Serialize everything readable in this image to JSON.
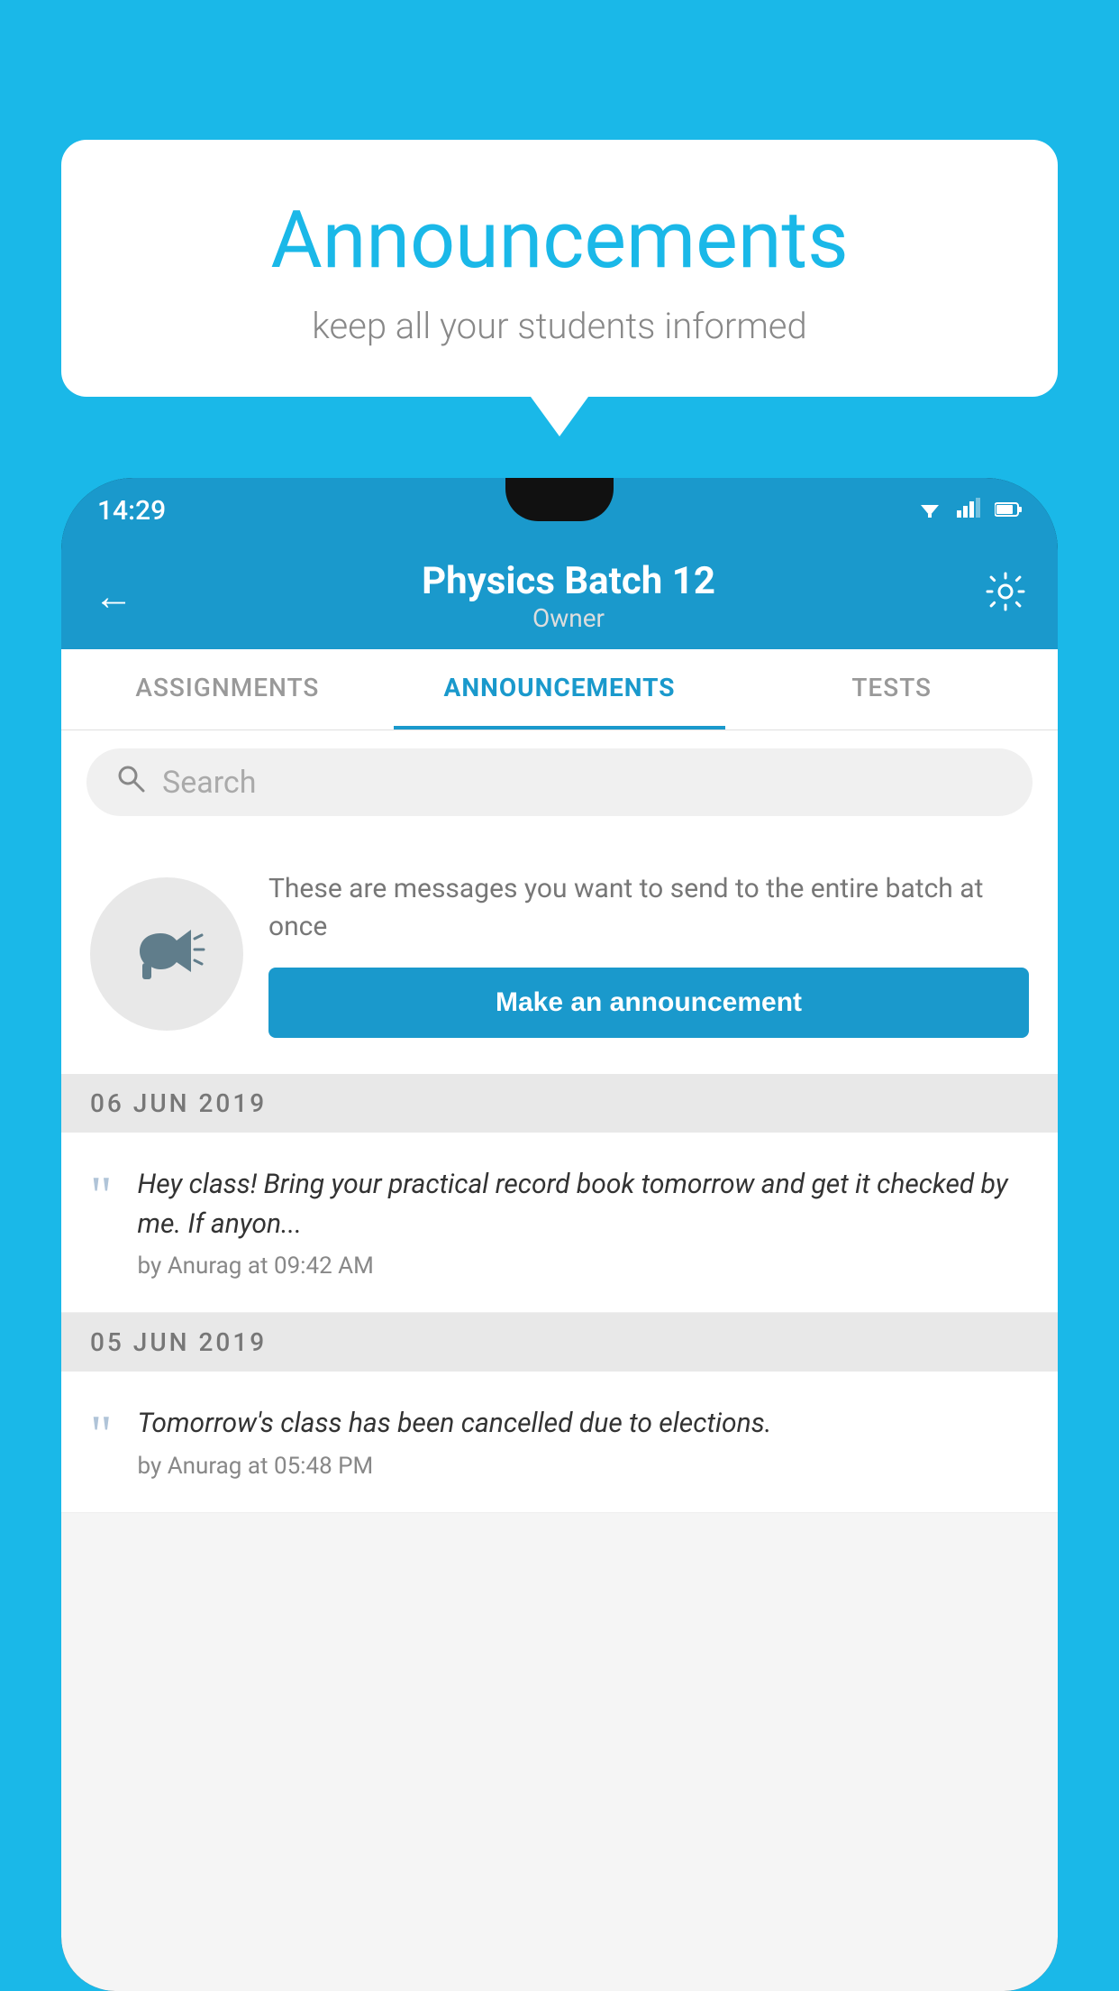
{
  "background_color": "#1ab8e8",
  "speech_bubble": {
    "title": "Announcements",
    "subtitle": "keep all your students informed"
  },
  "phone": {
    "status_bar": {
      "time": "14:29",
      "wifi_icon": "▾",
      "signal_icon": "▲",
      "battery_icon": "▮"
    },
    "app_bar": {
      "back_icon": "←",
      "title": "Physics Batch 12",
      "subtitle": "Owner",
      "gear_icon": "⚙"
    },
    "tabs": [
      {
        "label": "ASSIGNMENTS",
        "active": false
      },
      {
        "label": "ANNOUNCEMENTS",
        "active": true
      },
      {
        "label": "TESTS",
        "active": false
      },
      {
        "label": "...",
        "active": false
      }
    ],
    "search": {
      "placeholder": "Search",
      "icon": "🔍"
    },
    "promo": {
      "description": "These are messages you want to send to the entire batch at once",
      "button_label": "Make an announcement"
    },
    "announcements": [
      {
        "date": "06  JUN  2019",
        "body": "Hey class! Bring your practical record book tomorrow and get it checked by me. If anyon...",
        "meta": "by Anurag at 09:42 AM"
      },
      {
        "date": "05  JUN  2019",
        "body": "Tomorrow's class has been cancelled due to elections.",
        "meta": "by Anurag at 05:48 PM"
      }
    ]
  }
}
